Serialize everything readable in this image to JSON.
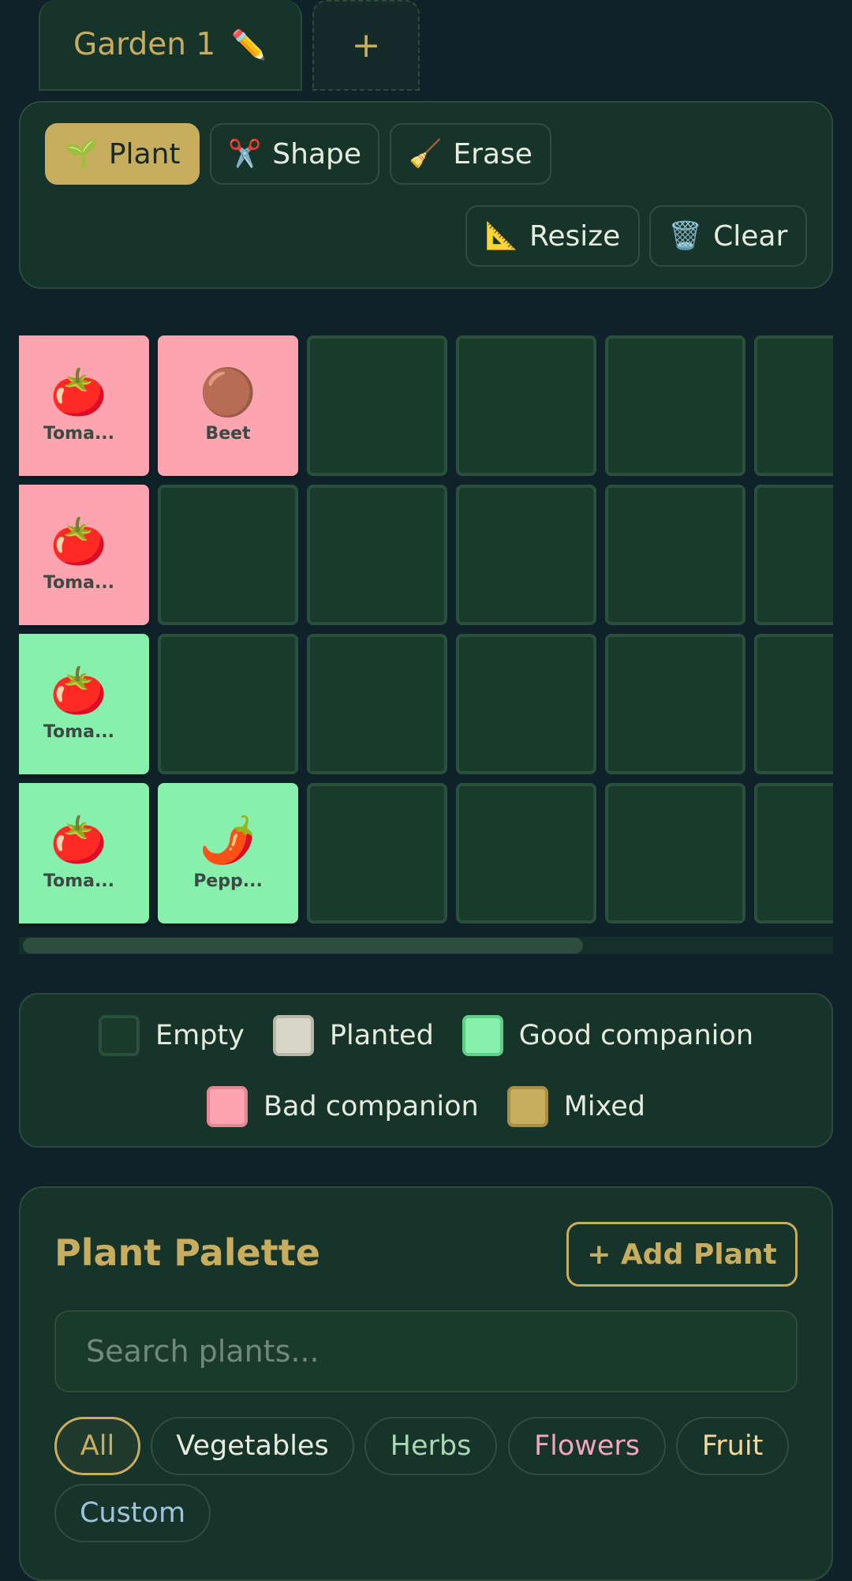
{
  "tabs": {
    "active_label": "Garden 1",
    "edit_icon": "pencil-icon",
    "add_label": "+"
  },
  "toolbar": {
    "plant": {
      "label": "Plant",
      "icon": "🌱"
    },
    "shape": {
      "label": "Shape",
      "icon": "✂️"
    },
    "erase": {
      "label": "Erase",
      "icon": "🧹"
    },
    "resize": {
      "label": "Resize",
      "icon": "📐"
    },
    "clear": {
      "label": "Clear",
      "icon": "🗑️"
    },
    "active_tool": "plant"
  },
  "grid": {
    "cells": [
      {
        "row": 0,
        "col": 0,
        "status": "bad",
        "emoji": "🍅",
        "label": "Toma..."
      },
      {
        "row": 0,
        "col": 1,
        "status": "bad",
        "emoji": "🟤",
        "label": "Beet"
      },
      {
        "row": 1,
        "col": 0,
        "status": "bad",
        "emoji": "🍅",
        "label": "Toma..."
      },
      {
        "row": 2,
        "col": 0,
        "status": "good",
        "emoji": "🍅",
        "label": "Toma..."
      },
      {
        "row": 3,
        "col": 0,
        "status": "good",
        "emoji": "🍅",
        "label": "Toma..."
      },
      {
        "row": 3,
        "col": 1,
        "status": "good",
        "emoji": "🌶️",
        "label": "Pepp..."
      }
    ]
  },
  "legend": {
    "empty": {
      "label": "Empty",
      "color": "#1a3a2c"
    },
    "planted": {
      "label": "Planted",
      "color": "#d8d5c9"
    },
    "good": {
      "label": "Good companion",
      "color": "#88f0ad"
    },
    "bad": {
      "label": "Bad companion",
      "color": "#fca5b1"
    },
    "mixed": {
      "label": "Mixed",
      "color": "#c9ad5e"
    }
  },
  "palette": {
    "title": "Plant Palette",
    "add_button": "+ Add Plant",
    "search_placeholder": "Search plants...",
    "filters": {
      "all": {
        "label": "All",
        "color": "#c9ad5e"
      },
      "vegetables": {
        "label": "Vegetables",
        "color": "#e6ecdf"
      },
      "herbs": {
        "label": "Herbs",
        "color": "#a9d7b3"
      },
      "flowers": {
        "label": "Flowers",
        "color": "#f0a5c0"
      },
      "fruit": {
        "label": "Fruit",
        "color": "#f3d89a"
      },
      "custom": {
        "label": "Custom",
        "color": "#9fc3de"
      }
    }
  },
  "colors": {
    "accent": "#c9ad5e",
    "background": "#0f222a",
    "panel": "#17342b"
  }
}
